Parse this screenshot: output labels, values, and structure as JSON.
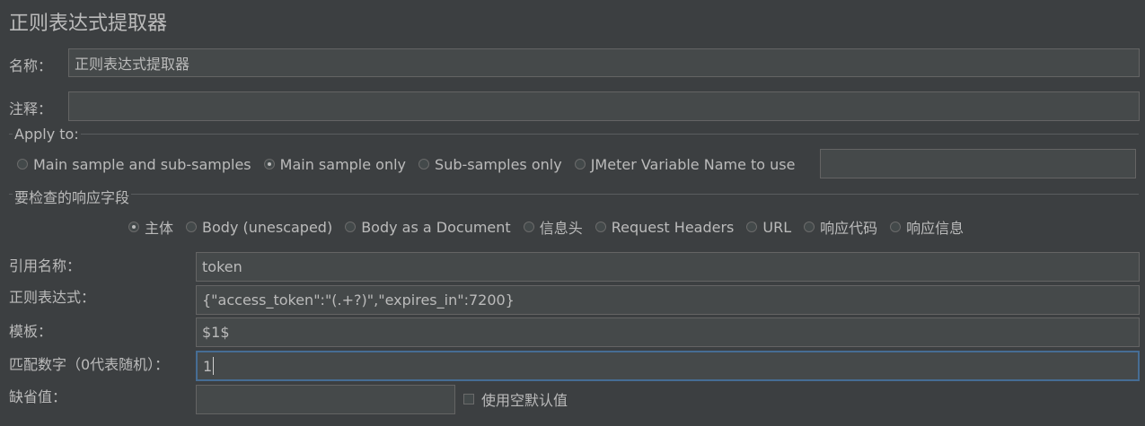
{
  "panel": {
    "title": "正则表达式提取器"
  },
  "name_field": {
    "label": "名称：",
    "value": "正则表达式提取器"
  },
  "comment_field": {
    "label": "注释：",
    "value": ""
  },
  "apply_to": {
    "title": "Apply to:",
    "options": [
      {
        "label": "Main sample and sub-samples",
        "selected": false
      },
      {
        "label": "Main sample only",
        "selected": true
      },
      {
        "label": "Sub-samples only",
        "selected": false
      },
      {
        "label": "JMeter Variable Name to use",
        "selected": false
      }
    ],
    "variable_name_value": ""
  },
  "response_field": {
    "title": "要检查的响应字段",
    "options": [
      {
        "label": "主体",
        "selected": true
      },
      {
        "label": "Body (unescaped)",
        "selected": false
      },
      {
        "label": "Body as a Document",
        "selected": false
      },
      {
        "label": "信息头",
        "selected": false
      },
      {
        "label": "Request Headers",
        "selected": false
      },
      {
        "label": "URL",
        "selected": false
      },
      {
        "label": "响应代码",
        "selected": false
      },
      {
        "label": "响应信息",
        "selected": false
      }
    ]
  },
  "ref_name": {
    "label": "引用名称：",
    "value": "token"
  },
  "regex": {
    "label": "正则表达式：",
    "value": "{\"access_token\":\"(.+?)\",\"expires_in\":7200}"
  },
  "template": {
    "label": "模板：",
    "value": "$1$"
  },
  "match_no": {
    "label": "匹配数字（0代表随机）：",
    "value": "1"
  },
  "default_value": {
    "label": "缺省值：",
    "value": "",
    "checkbox_label": "使用空默认值",
    "checked": false
  },
  "colors": {
    "background": "#3c3f41",
    "field": "#45494a",
    "focus_border": "#466d94"
  }
}
